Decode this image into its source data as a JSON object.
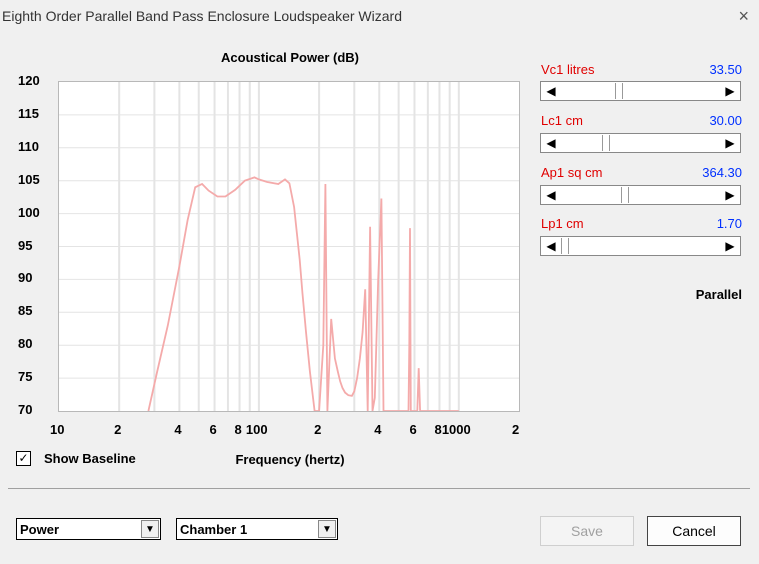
{
  "window": {
    "title": "Eighth Order Parallel Band Pass Enclosure Loudspeaker Wizard",
    "close_icon": "×"
  },
  "chart_data": {
    "type": "line",
    "title": "Acoustical Power (dB)",
    "xlabel": "Frequency (hertz)",
    "ylabel": "",
    "x_scale": "log",
    "xlim": [
      10,
      2000
    ],
    "ylim": [
      70,
      120
    ],
    "yticks": [
      "120",
      "115",
      "110",
      "105",
      "100",
      "95",
      "90",
      "85",
      "80",
      "75",
      "70"
    ],
    "xticks": [
      "10",
      "2",
      "4",
      "6",
      "8",
      "100",
      "2",
      "4",
      "6",
      "8",
      "1000",
      "2"
    ],
    "grid": true,
    "series": [
      {
        "color": "#f4aaaa",
        "x": [
          28,
          31,
          35,
          40,
          44,
          48,
          52,
          56,
          62,
          68,
          76,
          85,
          95,
          100,
          110,
          125,
          135,
          142,
          150,
          160,
          165,
          172,
          180,
          190,
          200,
          205,
          210,
          215,
          220,
          230,
          240,
          248,
          255,
          262,
          270,
          280,
          292,
          300,
          310,
          320,
          330,
          340,
          350,
          360,
          370,
          380,
          395,
          410,
          420,
          430,
          440,
          450,
          460,
          470,
          480,
          490,
          500,
          505,
          510,
          515,
          520,
          525,
          530,
          535,
          540,
          545,
          550,
          555,
          560,
          565,
          570,
          575,
          580,
          590,
          600,
          610,
          620,
          630,
          640,
          650,
          660,
          670,
          680,
          690,
          700,
          710,
          720,
          730,
          740,
          760,
          780,
          800,
          830,
          850,
          870,
          900,
          920,
          940,
          960,
          980,
          1000
        ],
        "y": [
          70,
          76,
          83,
          92,
          99,
          104,
          104.5,
          103.5,
          102.6,
          102.6,
          103.6,
          105,
          105.5,
          105.2,
          104.8,
          104.5,
          105.2,
          104.6,
          101,
          93,
          88,
          82,
          76,
          70,
          70,
          75,
          80,
          104.5,
          70,
          84,
          78,
          76,
          74.5,
          73.5,
          72.8,
          72.4,
          72.3,
          73,
          75,
          78,
          82,
          88.5,
          70,
          98,
          70,
          72,
          90,
          102.3,
          70,
          70,
          70,
          70,
          70,
          70,
          70,
          70,
          70,
          70,
          70,
          70,
          70,
          70,
          70,
          70,
          70,
          70,
          70,
          70,
          70,
          80,
          97.8,
          70,
          70,
          70,
          70,
          70,
          70,
          76.5,
          70,
          70,
          70,
          70,
          70,
          70,
          70,
          70,
          70,
          70,
          70,
          70,
          70,
          70,
          70,
          70,
          70,
          70,
          70,
          70,
          70,
          70,
          70
        ]
      }
    ]
  },
  "options": {
    "show_baseline_label": "Show Baseline",
    "show_baseline_checked": "✓"
  },
  "params": [
    {
      "label": "Vc1  litres",
      "value": "33.50",
      "level": 0.36
    },
    {
      "label": "Lc1  cm",
      "value": "30.00",
      "level": 0.27
    },
    {
      "label": "Ap1  sq cm",
      "value": "364.30",
      "level": 0.4
    },
    {
      "label": "Lp1  cm",
      "value": "1.70",
      "level": 0.0
    }
  ],
  "config_label": "Parallel",
  "selects": {
    "view": "Power",
    "chamber": "Chamber 1"
  },
  "buttons": {
    "save": "Save",
    "cancel": "Cancel"
  },
  "icons": {
    "left": "◀",
    "right": "▶",
    "dropdown": "▼"
  }
}
